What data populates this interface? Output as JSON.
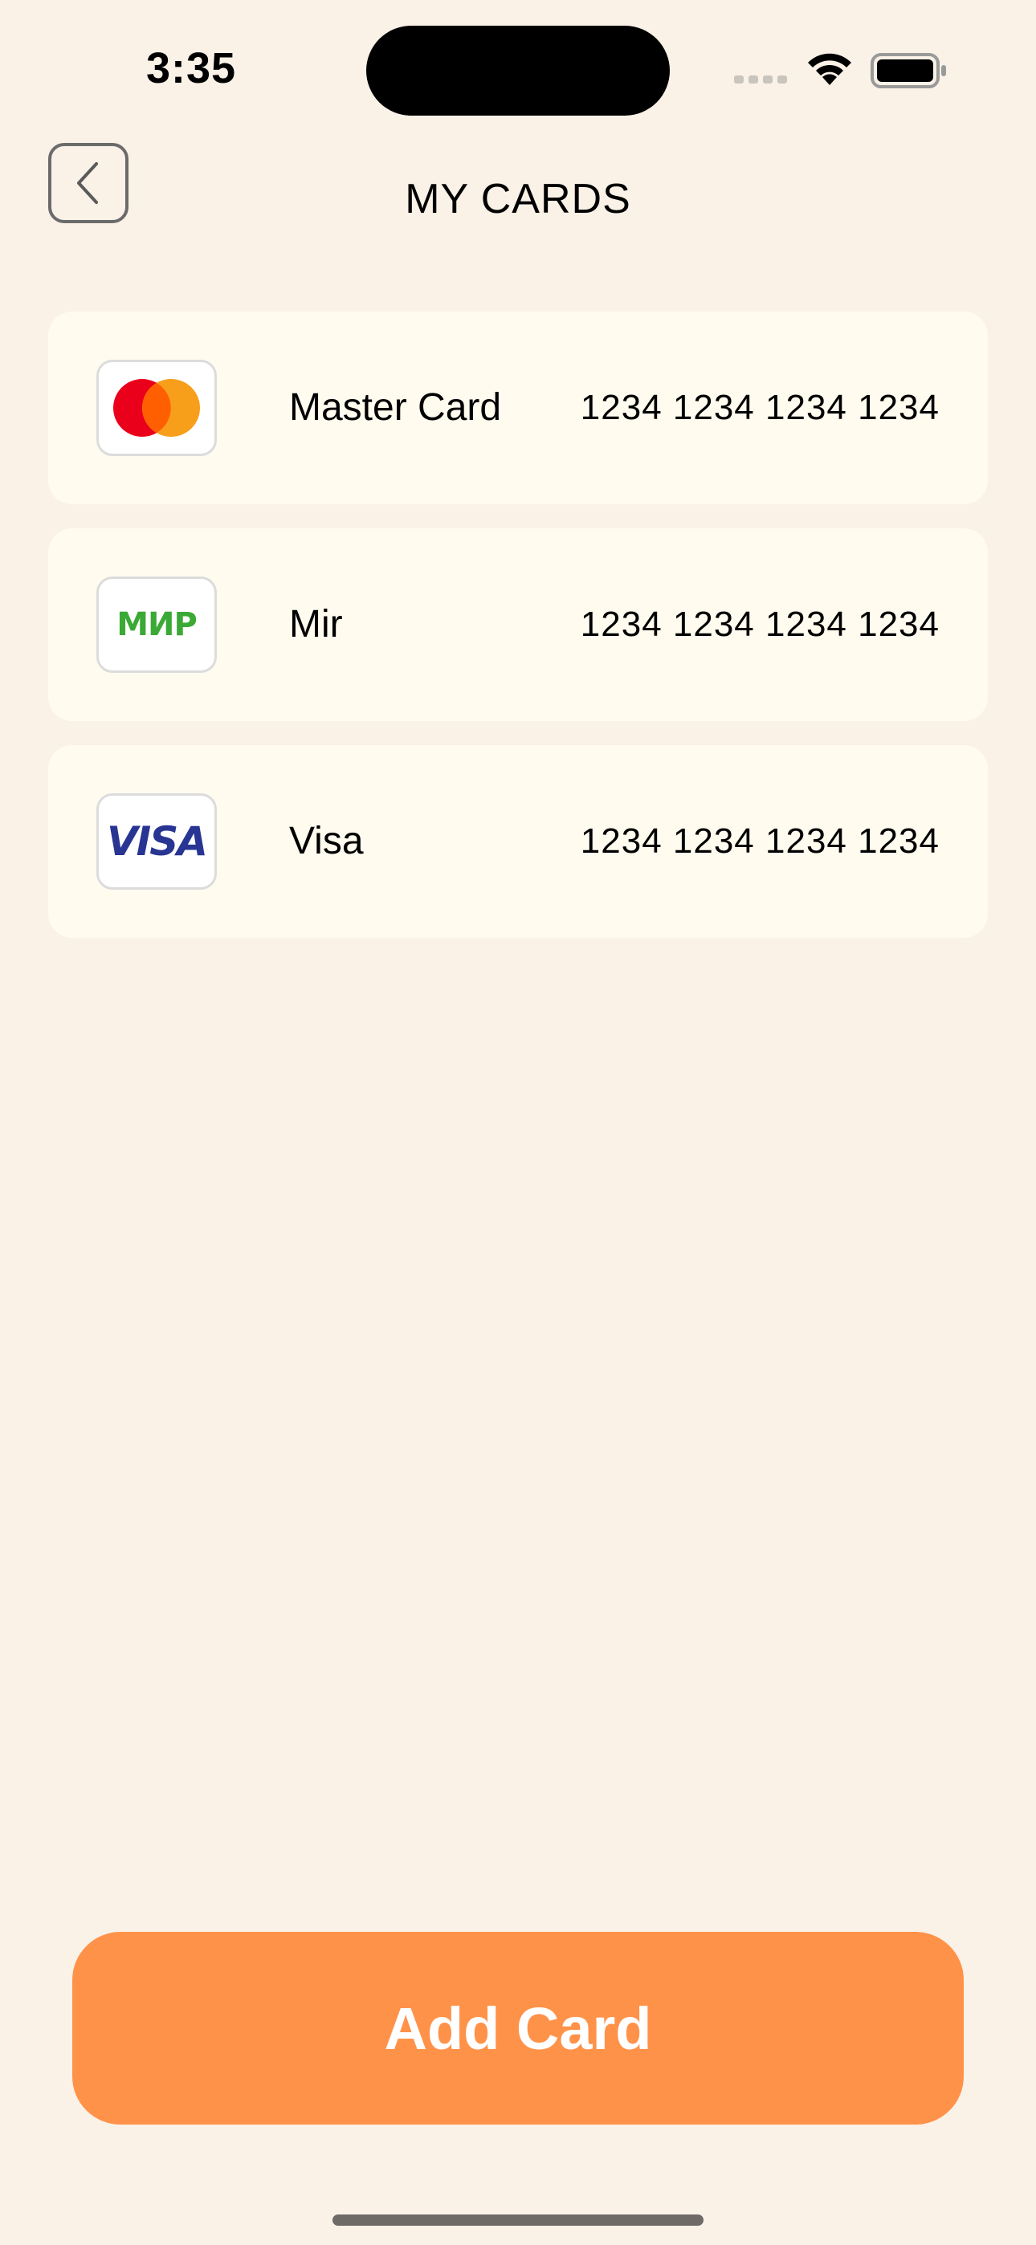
{
  "status_bar": {
    "time": "3:35"
  },
  "header": {
    "title": "MY CARDS",
    "back_icon": "chevron-left-icon"
  },
  "cards": [
    {
      "name": "Master Card",
      "number": "1234 1234 1234 1234",
      "logo": "mastercard-logo"
    },
    {
      "name": "Mir",
      "number": "1234 1234 1234 1234",
      "logo": "mir-logo",
      "logo_text": "МИР"
    },
    {
      "name": "Visa",
      "number": "1234 1234 1234 1234",
      "logo": "visa-logo",
      "logo_text": "VISA"
    }
  ],
  "actions": {
    "add_card_label": "Add Card"
  },
  "colors": {
    "background": "#FAF1E7",
    "card_background": "#FFFBEF",
    "accent": "#FF9249"
  }
}
